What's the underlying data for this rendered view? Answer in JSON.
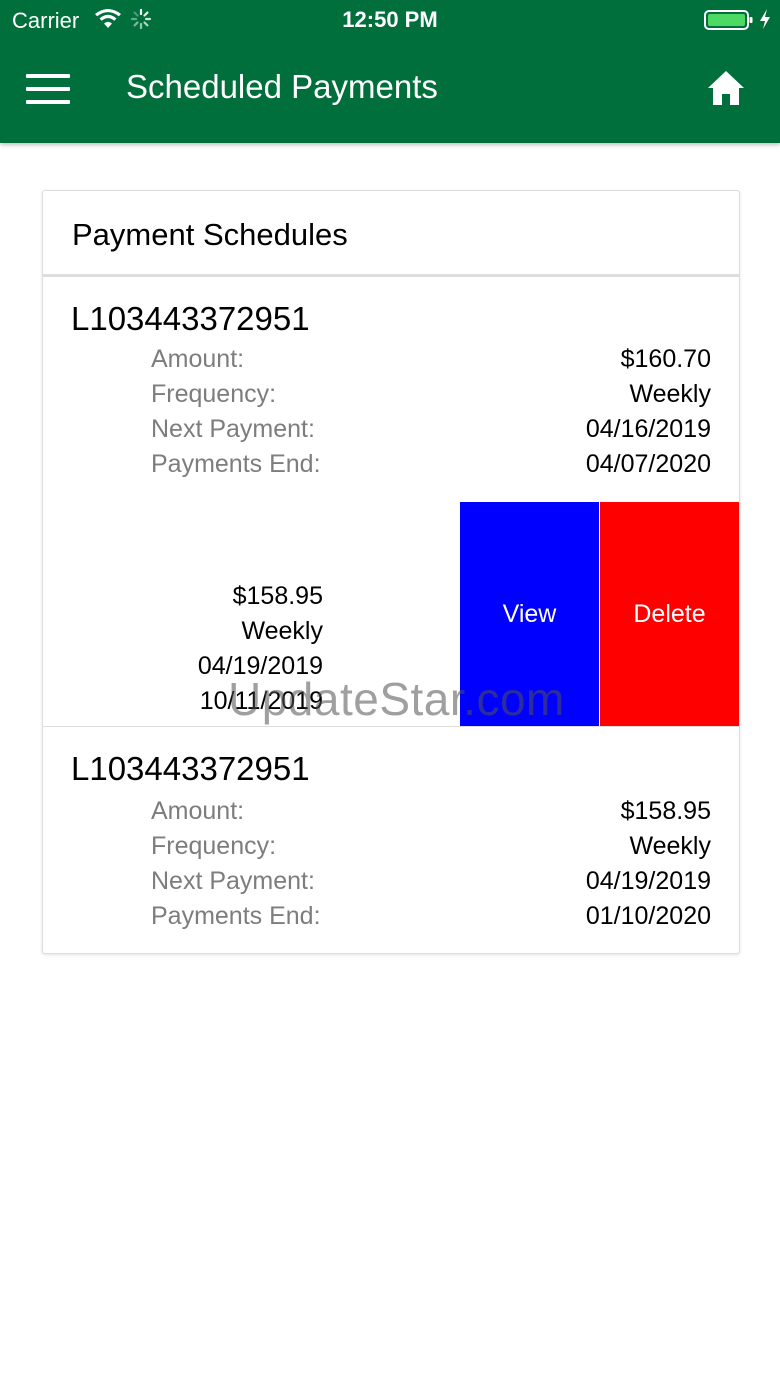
{
  "status_bar": {
    "carrier": "Carrier",
    "time": "12:50 PM",
    "battery_color": "#4cd964"
  },
  "header": {
    "title": "Scheduled Payments",
    "background": "#006f3c",
    "menu_icon": "hamburger-menu-icon",
    "home_icon": "home-icon"
  },
  "card": {
    "title": "Payment Schedules"
  },
  "labels": {
    "amount": "Amount:",
    "frequency": "Frequency:",
    "next_payment": "Next Payment:",
    "payments_end": "Payments End:"
  },
  "schedules": [
    {
      "loan_id": "L103443372951",
      "amount": "$160.70",
      "frequency": "Weekly",
      "next_payment": "04/16/2019",
      "payments_end": "04/07/2020"
    },
    {
      "loan_id": "",
      "amount": "$158.95",
      "frequency": "Weekly",
      "next_payment": "04/19/2019",
      "payments_end": "10/11/2019",
      "swipe_actions": {
        "view_label": "View",
        "view_color": "#0000ff",
        "delete_label": "Delete",
        "delete_color": "#ff0000"
      }
    },
    {
      "loan_id": "L103443372951",
      "amount": "$158.95",
      "frequency": "Weekly",
      "next_payment": "04/19/2019",
      "payments_end": "01/10/2020"
    }
  ],
  "watermark": "UpdateStar.com"
}
